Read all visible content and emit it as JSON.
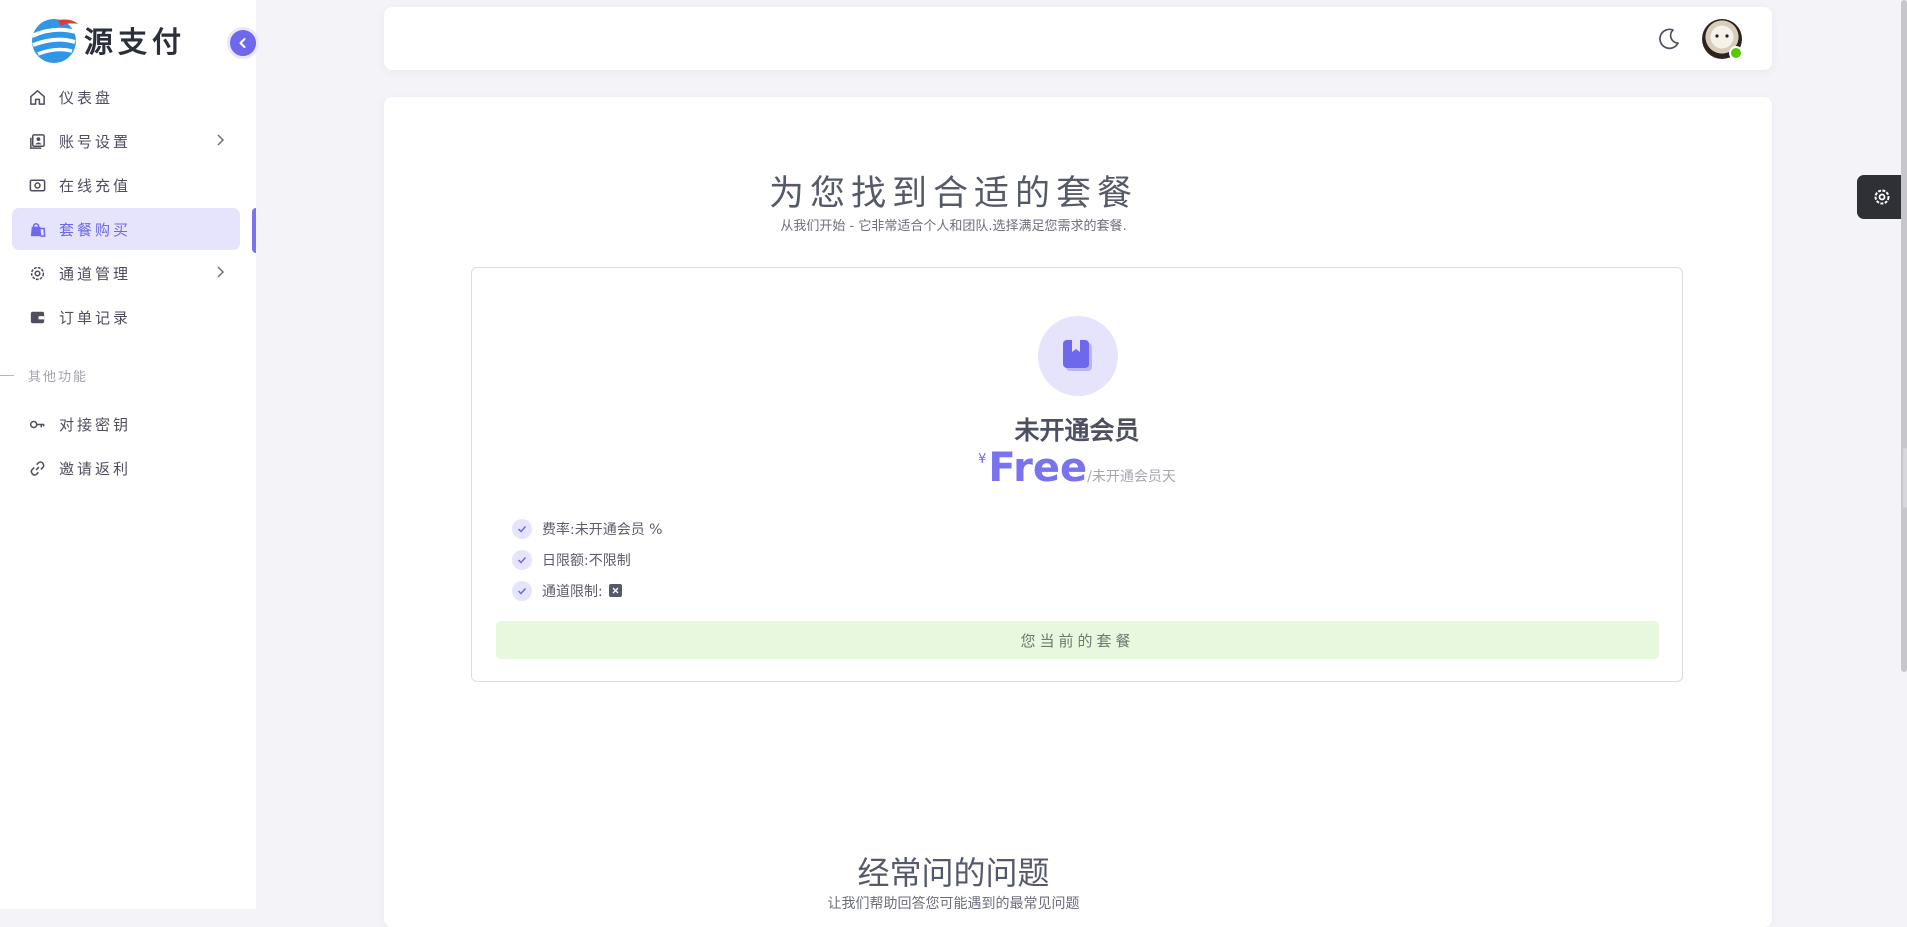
{
  "brand": {
    "name": "源支付"
  },
  "sidebar": {
    "items": [
      {
        "label": "仪表盘",
        "icon": "home-icon",
        "active": false,
        "has_children": false
      },
      {
        "label": "账号设置",
        "icon": "user-card-icon",
        "active": false,
        "has_children": true
      },
      {
        "label": "在线充值",
        "icon": "cash-icon",
        "active": false,
        "has_children": false
      },
      {
        "label": "套餐购买",
        "icon": "shopping-bag-icon",
        "active": true,
        "has_children": false
      },
      {
        "label": "通道管理",
        "icon": "gear-icon",
        "active": false,
        "has_children": true
      },
      {
        "label": "订单记录",
        "icon": "wallet-icon",
        "active": false,
        "has_children": false
      }
    ],
    "section_title": "其他功能",
    "items2": [
      {
        "label": "对接密钥",
        "icon": "key-icon"
      },
      {
        "label": "邀请返利",
        "icon": "link-icon"
      }
    ]
  },
  "pricing": {
    "title": "为您找到合适的套餐",
    "subtitle": "从我们开始 - 它非常适合个人和团队.选择满足您需求的套餐.",
    "plan": {
      "name": "未开通会员",
      "currency": "¥",
      "price": "Free",
      "period": "/未开通会员天",
      "features": [
        {
          "label": "费率:",
          "value": "未开通会员 %"
        },
        {
          "label": "日限额:",
          "value": "不限制"
        },
        {
          "label": "通道限制:",
          "value": ""
        }
      ],
      "button_label": "您当前的套餐"
    }
  },
  "faq": {
    "title": "经常问的问题",
    "subtitle": "让我们帮助回答您可能遇到的最常见问题"
  },
  "colors": {
    "accent": "#7a73ef",
    "accent_light": "#e6e4fc",
    "success_bg": "#e7f8de",
    "online": "#56ca00"
  }
}
